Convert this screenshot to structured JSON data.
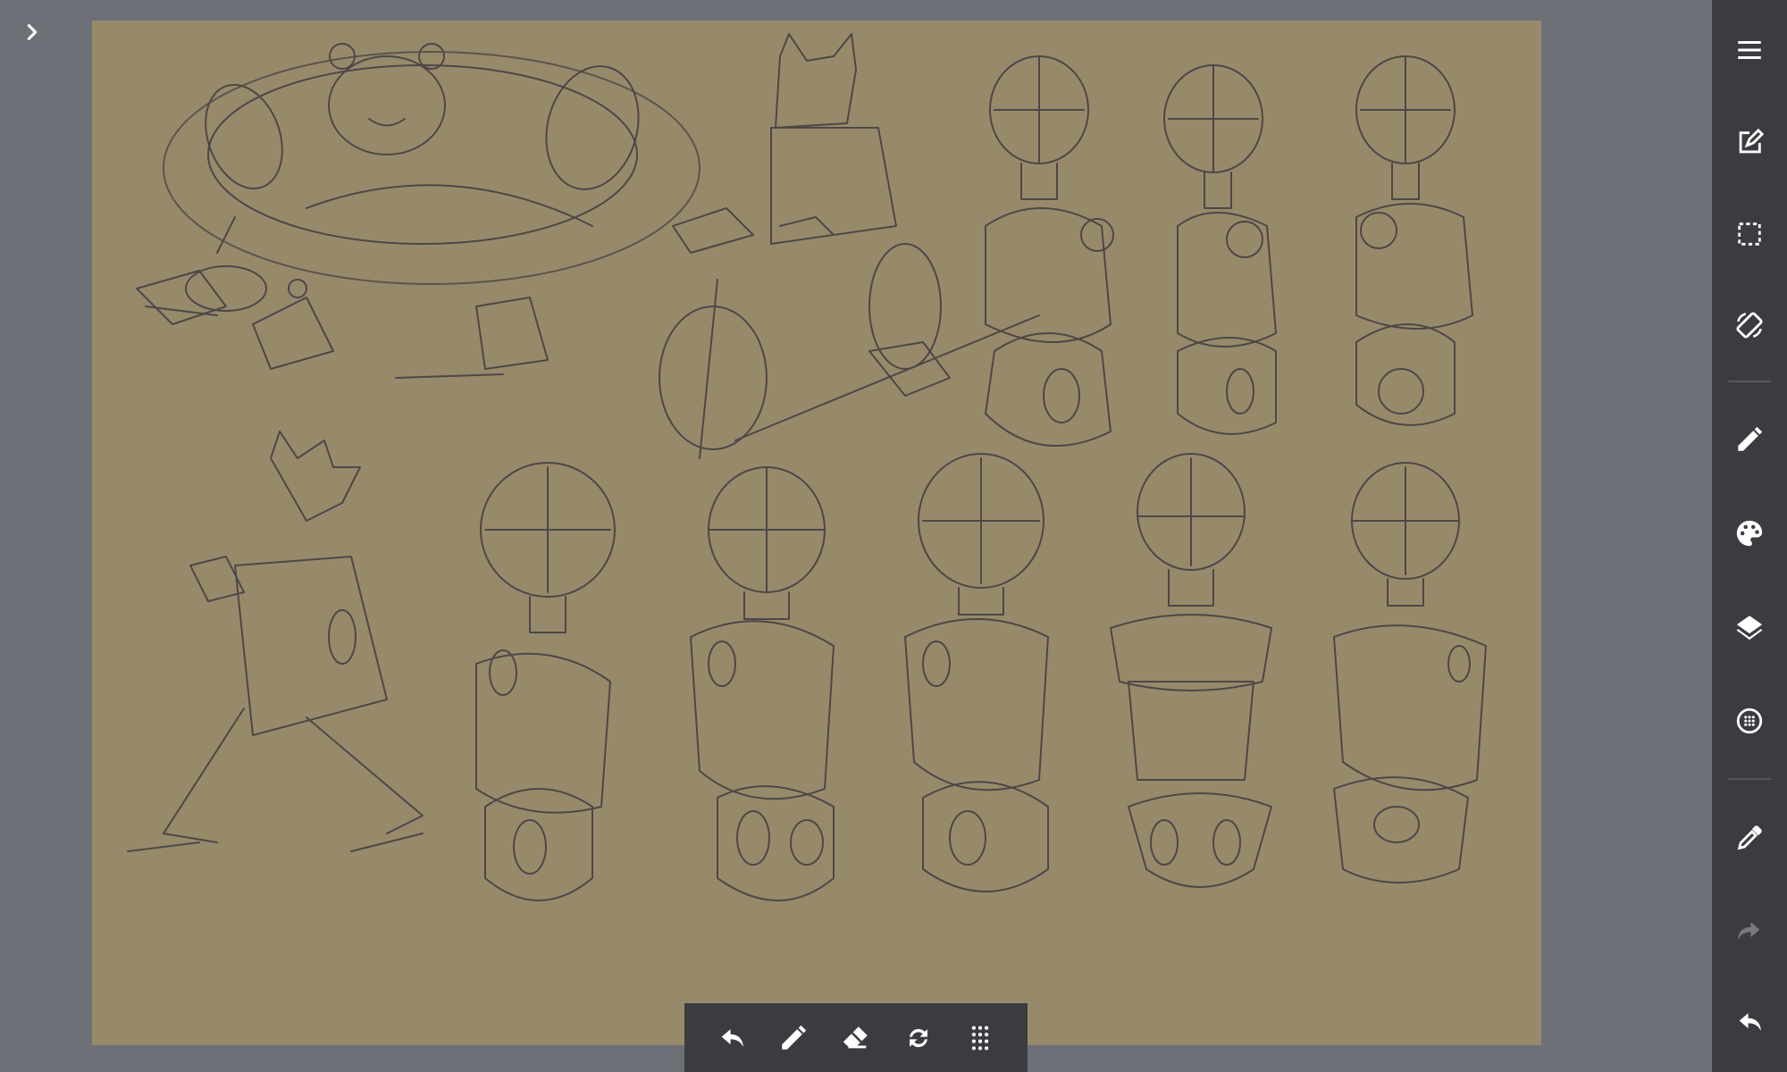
{
  "app": {
    "canvas_color": "#978a6b",
    "toolbar_color": "#3b3c40",
    "background_color": "#6e7077",
    "icon_color": "#ffffff",
    "disabled_icon_color": "#77797e"
  },
  "left": {
    "expand_icon": "chevron-right-icon"
  },
  "right_toolbar": {
    "items": [
      {
        "icon": "menu-icon"
      },
      {
        "icon": "edit-document-icon"
      },
      {
        "icon": "selection-icon"
      },
      {
        "icon": "rotate-screen-icon"
      },
      {
        "icon": "pencil-icon"
      },
      {
        "icon": "palette-icon"
      },
      {
        "icon": "layers-icon"
      },
      {
        "icon": "texture-icon"
      },
      {
        "icon": "eyedropper-icon"
      },
      {
        "icon": "redo-icon",
        "disabled": true
      },
      {
        "icon": "undo-icon"
      }
    ]
  },
  "bottom_toolbar": {
    "items": [
      {
        "icon": "undo-icon"
      },
      {
        "icon": "pencil-icon"
      },
      {
        "icon": "eraser-icon"
      },
      {
        "icon": "swap-icon"
      },
      {
        "icon": "grid-dots-icon"
      }
    ]
  }
}
